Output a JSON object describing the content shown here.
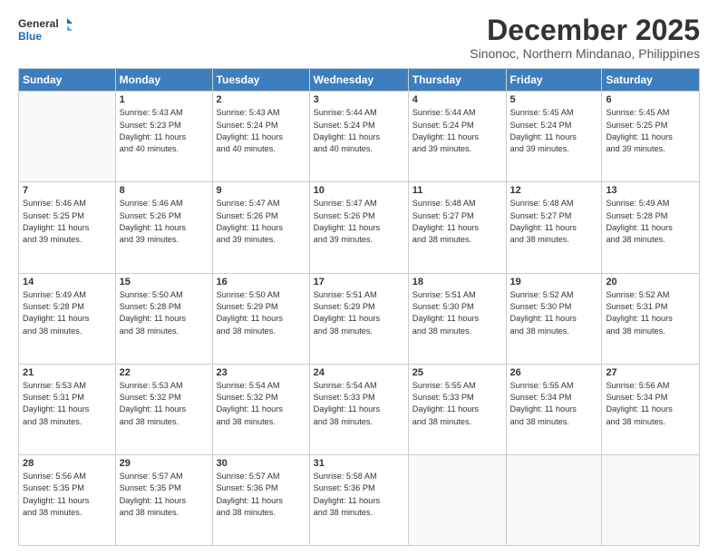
{
  "logo": {
    "line1": "General",
    "line2": "Blue"
  },
  "title": "December 2025",
  "location": "Sinonoc, Northern Mindanao, Philippines",
  "days_of_week": [
    "Sunday",
    "Monday",
    "Tuesday",
    "Wednesday",
    "Thursday",
    "Friday",
    "Saturday"
  ],
  "weeks": [
    [
      {
        "day": "",
        "info": ""
      },
      {
        "day": "1",
        "info": "Sunrise: 5:43 AM\nSunset: 5:23 PM\nDaylight: 11 hours\nand 40 minutes."
      },
      {
        "day": "2",
        "info": "Sunrise: 5:43 AM\nSunset: 5:24 PM\nDaylight: 11 hours\nand 40 minutes."
      },
      {
        "day": "3",
        "info": "Sunrise: 5:44 AM\nSunset: 5:24 PM\nDaylight: 11 hours\nand 40 minutes."
      },
      {
        "day": "4",
        "info": "Sunrise: 5:44 AM\nSunset: 5:24 PM\nDaylight: 11 hours\nand 39 minutes."
      },
      {
        "day": "5",
        "info": "Sunrise: 5:45 AM\nSunset: 5:24 PM\nDaylight: 11 hours\nand 39 minutes."
      },
      {
        "day": "6",
        "info": "Sunrise: 5:45 AM\nSunset: 5:25 PM\nDaylight: 11 hours\nand 39 minutes."
      }
    ],
    [
      {
        "day": "7",
        "info": "Sunrise: 5:46 AM\nSunset: 5:25 PM\nDaylight: 11 hours\nand 39 minutes."
      },
      {
        "day": "8",
        "info": "Sunrise: 5:46 AM\nSunset: 5:26 PM\nDaylight: 11 hours\nand 39 minutes."
      },
      {
        "day": "9",
        "info": "Sunrise: 5:47 AM\nSunset: 5:26 PM\nDaylight: 11 hours\nand 39 minutes."
      },
      {
        "day": "10",
        "info": "Sunrise: 5:47 AM\nSunset: 5:26 PM\nDaylight: 11 hours\nand 39 minutes."
      },
      {
        "day": "11",
        "info": "Sunrise: 5:48 AM\nSunset: 5:27 PM\nDaylight: 11 hours\nand 38 minutes."
      },
      {
        "day": "12",
        "info": "Sunrise: 5:48 AM\nSunset: 5:27 PM\nDaylight: 11 hours\nand 38 minutes."
      },
      {
        "day": "13",
        "info": "Sunrise: 5:49 AM\nSunset: 5:28 PM\nDaylight: 11 hours\nand 38 minutes."
      }
    ],
    [
      {
        "day": "14",
        "info": "Sunrise: 5:49 AM\nSunset: 5:28 PM\nDaylight: 11 hours\nand 38 minutes."
      },
      {
        "day": "15",
        "info": "Sunrise: 5:50 AM\nSunset: 5:28 PM\nDaylight: 11 hours\nand 38 minutes."
      },
      {
        "day": "16",
        "info": "Sunrise: 5:50 AM\nSunset: 5:29 PM\nDaylight: 11 hours\nand 38 minutes."
      },
      {
        "day": "17",
        "info": "Sunrise: 5:51 AM\nSunset: 5:29 PM\nDaylight: 11 hours\nand 38 minutes."
      },
      {
        "day": "18",
        "info": "Sunrise: 5:51 AM\nSunset: 5:30 PM\nDaylight: 11 hours\nand 38 minutes."
      },
      {
        "day": "19",
        "info": "Sunrise: 5:52 AM\nSunset: 5:30 PM\nDaylight: 11 hours\nand 38 minutes."
      },
      {
        "day": "20",
        "info": "Sunrise: 5:52 AM\nSunset: 5:31 PM\nDaylight: 11 hours\nand 38 minutes."
      }
    ],
    [
      {
        "day": "21",
        "info": "Sunrise: 5:53 AM\nSunset: 5:31 PM\nDaylight: 11 hours\nand 38 minutes."
      },
      {
        "day": "22",
        "info": "Sunrise: 5:53 AM\nSunset: 5:32 PM\nDaylight: 11 hours\nand 38 minutes."
      },
      {
        "day": "23",
        "info": "Sunrise: 5:54 AM\nSunset: 5:32 PM\nDaylight: 11 hours\nand 38 minutes."
      },
      {
        "day": "24",
        "info": "Sunrise: 5:54 AM\nSunset: 5:33 PM\nDaylight: 11 hours\nand 38 minutes."
      },
      {
        "day": "25",
        "info": "Sunrise: 5:55 AM\nSunset: 5:33 PM\nDaylight: 11 hours\nand 38 minutes."
      },
      {
        "day": "26",
        "info": "Sunrise: 5:55 AM\nSunset: 5:34 PM\nDaylight: 11 hours\nand 38 minutes."
      },
      {
        "day": "27",
        "info": "Sunrise: 5:56 AM\nSunset: 5:34 PM\nDaylight: 11 hours\nand 38 minutes."
      }
    ],
    [
      {
        "day": "28",
        "info": "Sunrise: 5:56 AM\nSunset: 5:35 PM\nDaylight: 11 hours\nand 38 minutes."
      },
      {
        "day": "29",
        "info": "Sunrise: 5:57 AM\nSunset: 5:35 PM\nDaylight: 11 hours\nand 38 minutes."
      },
      {
        "day": "30",
        "info": "Sunrise: 5:57 AM\nSunset: 5:36 PM\nDaylight: 11 hours\nand 38 minutes."
      },
      {
        "day": "31",
        "info": "Sunrise: 5:58 AM\nSunset: 5:36 PM\nDaylight: 11 hours\nand 38 minutes."
      },
      {
        "day": "",
        "info": ""
      },
      {
        "day": "",
        "info": ""
      },
      {
        "day": "",
        "info": ""
      }
    ]
  ]
}
